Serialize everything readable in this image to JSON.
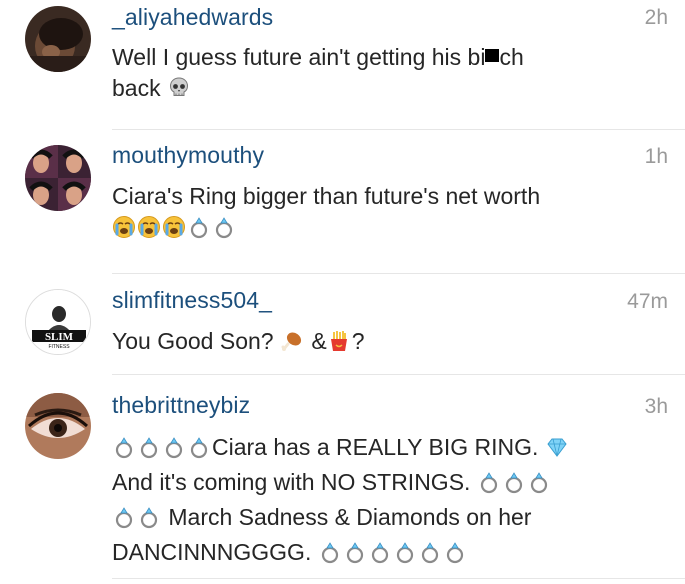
{
  "comments": [
    {
      "username": "_aliyahedwards",
      "time": "2h",
      "text1a": "Well I guess future ain't getting his bi",
      "text1b": "ch",
      "text2": "back",
      "emoji": [
        "skull-emoji"
      ]
    },
    {
      "username": "mouthymouthy",
      "time": "1h",
      "text1": "Ciara's Ring bigger than future's net worth",
      "emoji": [
        "crying-face-emoji",
        "crying-face-emoji",
        "crying-face-emoji",
        "ring-emoji",
        "ring-emoji"
      ]
    },
    {
      "username": "slimfitness504_",
      "time": "47m",
      "text_a": "You Good Son?",
      "text_b": "&",
      "text_c": "?",
      "avatar_logo": "SLIM",
      "avatar_logo_sub": "FITNESS",
      "emoji": [
        "poultry-leg-emoji",
        "french-fries-emoji"
      ]
    },
    {
      "username": "thebrittneybiz",
      "time": "3h",
      "line1": "Ciara has a REALLY BIG RING.",
      "line2": "And it's coming with NO STRINGS.",
      "line3": "March Sadness & Diamonds on her",
      "line4": "DANCINNNGGGG.",
      "emoji": [
        "ring-emoji",
        "gem-emoji"
      ]
    }
  ],
  "colors": {
    "username": "#1c4f7c",
    "text": "#262626",
    "timestamp": "#9a9a9a",
    "divider": "#e6e6e6"
  }
}
